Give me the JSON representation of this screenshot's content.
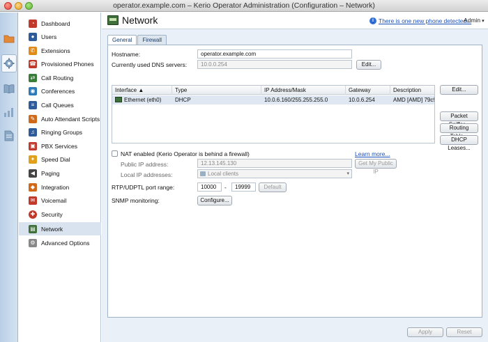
{
  "window": {
    "title": "operator.example.com – Kerio Operator Administration (Configuration – Network)"
  },
  "rail": [
    {
      "name": "folder-icon",
      "color": "#e38a3a"
    },
    {
      "name": "gear-icon",
      "color": "#6f8fb3",
      "active": true
    },
    {
      "name": "book-icon",
      "color": "#6f8fb3"
    },
    {
      "name": "bar-chart-icon",
      "color": "#6f8fb3"
    },
    {
      "name": "document-icon",
      "color": "#6f8fb3"
    }
  ],
  "sidebar": {
    "items": [
      {
        "label": "Dashboard",
        "icon": "dashboard-icon",
        "color": "#c0392b"
      },
      {
        "label": "Users",
        "icon": "users-icon",
        "color": "#2e5c9a"
      },
      {
        "label": "Extensions",
        "icon": "phone-icon",
        "color": "#e08a1a"
      },
      {
        "label": "Provisioned Phones",
        "icon": "provisioned-phone-icon",
        "color": "#c0392b"
      },
      {
        "label": "Call Routing",
        "icon": "call-routing-icon",
        "color": "#3a7d3a"
      },
      {
        "label": "Conferences",
        "icon": "conference-icon",
        "color": "#2e7ab8"
      },
      {
        "label": "Call Queues",
        "icon": "call-queue-icon",
        "color": "#2e5c9a"
      },
      {
        "label": "Auto Attendant Scripts",
        "icon": "script-icon",
        "color": "#d06a1a"
      },
      {
        "label": "Ringing Groups",
        "icon": "ringing-group-icon",
        "color": "#2e5c9a"
      },
      {
        "label": "PBX Services",
        "icon": "pbx-services-icon",
        "color": "#c0392b"
      },
      {
        "label": "Speed Dial",
        "icon": "speed-dial-icon",
        "color": "#e0a01a"
      },
      {
        "label": "Paging",
        "icon": "paging-icon",
        "color": "#444444"
      },
      {
        "label": "Integration",
        "icon": "integration-icon",
        "color": "#d06a1a"
      },
      {
        "label": "Voicemail",
        "icon": "voicemail-icon",
        "color": "#c0392b"
      },
      {
        "label": "Security",
        "icon": "security-icon",
        "color": "#c0392b"
      },
      {
        "label": "Network",
        "icon": "network-icon",
        "color": "#3f6f3a",
        "active": true
      },
      {
        "label": "Advanced Options",
        "icon": "advanced-options-icon",
        "color": "#888888"
      }
    ]
  },
  "header": {
    "title": "Network",
    "notification": "There is one new phone detected...",
    "user": "Admin"
  },
  "tabs": [
    {
      "label": "General",
      "active": true
    },
    {
      "label": "Firewall",
      "active": false
    }
  ],
  "general": {
    "hostname_label": "Hostname:",
    "hostname_value": "operator.example.com",
    "dns_label": "Currently used DNS servers:",
    "dns_value": "10.0.0.254",
    "dns_edit_button": "Edit...",
    "grid": {
      "columns": [
        "Interface ▲",
        "Type",
        "IP Address/Mask",
        "Gateway",
        "Description"
      ],
      "rows": [
        {
          "interface": "Ethernet (eth0)",
          "type": "DHCP",
          "ip": "10.0.6.160/255.255.255.0",
          "gateway": "10.0.6.254",
          "description": "AMD [AMD] 79c9..."
        }
      ]
    },
    "side_buttons": {
      "edit": "Edit...",
      "packet_sniffer": "Packet Sniffer...",
      "routing_table": "Routing Table...",
      "dhcp_leases": "DHCP Leases..."
    },
    "nat_label": "NAT enabled (Kerio Operator is behind a firewall)",
    "nat_checked": false,
    "learn_more": "Learn more...",
    "public_ip_label": "Public IP address:",
    "public_ip_value": "12.13.145.130",
    "get_public_ip_button": "Get My Public IP",
    "local_ip_label": "Local IP addresses:",
    "local_ip_value": "Local clients",
    "rtp_label": "RTP/UDPTL port range:",
    "rtp_from": "10000",
    "rtp_separator": "-",
    "rtp_to": "19999",
    "default_button": "Default",
    "snmp_label": "SNMP monitoring:",
    "configure_button": "Configure..."
  },
  "footer": {
    "apply": "Apply",
    "reset": "Reset"
  }
}
